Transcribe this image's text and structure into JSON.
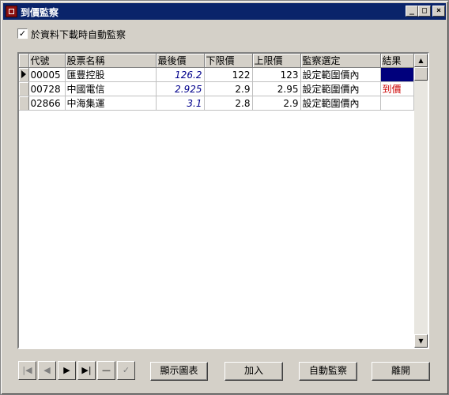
{
  "window": {
    "title": "到價監察"
  },
  "auto_check": {
    "label": "於資料下載時自動監察",
    "checked": true
  },
  "grid": {
    "columns": [
      "代號",
      "股票名稱",
      "最後價",
      "下限價",
      "上限價",
      "監察選定",
      "結果"
    ],
    "rows": [
      {
        "code": "00005",
        "name": "匯豐控股",
        "last": "126.2",
        "low": "122",
        "high": "123",
        "mode": "設定範圍價內",
        "result": ""
      },
      {
        "code": "00728",
        "name": "中國電信",
        "last": "2.925",
        "low": "2.9",
        "high": "2.95",
        "mode": "設定範圍價內",
        "result": "到價"
      },
      {
        "code": "02866",
        "name": "中海集運",
        "last": "3.1",
        "low": "2.8",
        "high": "2.9",
        "mode": "設定範圍價內",
        "result": ""
      }
    ]
  },
  "nav": {
    "first": "|◀",
    "prev": "◀",
    "next": "▶",
    "last": "▶|",
    "delete": "—",
    "post": "✓"
  },
  "buttons": {
    "chart": "顯示圖表",
    "add": "加入",
    "auto": "自動監察",
    "close": "離開"
  },
  "icons": {
    "window_icon": "app-icon",
    "scroll_up": "▲",
    "scroll_down": "▼"
  },
  "colors": {
    "title_bar": "#0a246a",
    "price_blue": "#00008b",
    "alert_red": "#cc0000",
    "selection": "#00007c"
  }
}
